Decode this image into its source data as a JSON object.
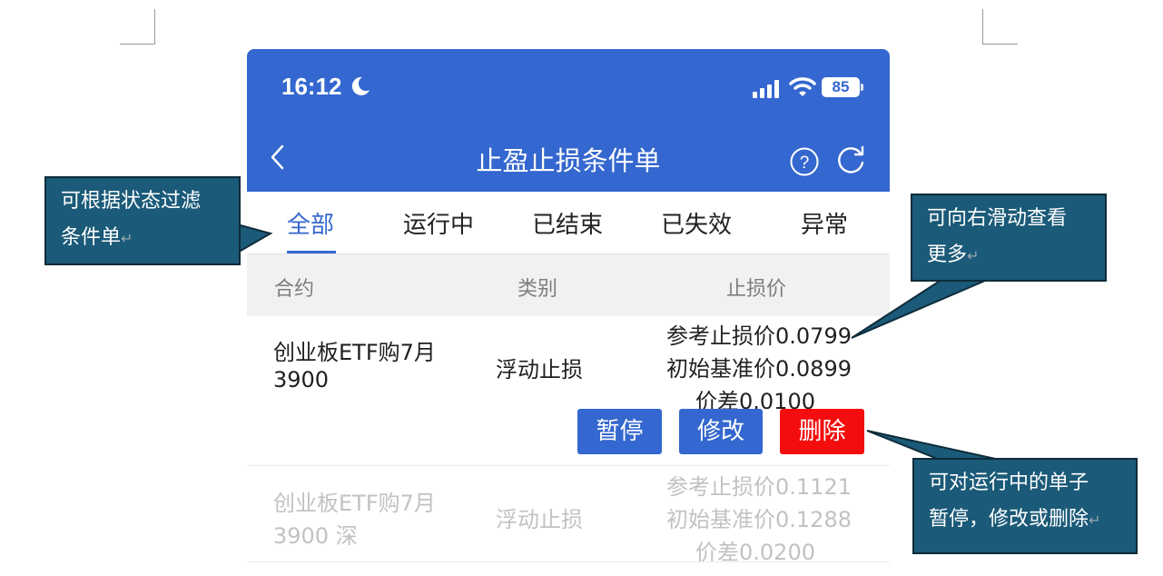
{
  "status_bar": {
    "time": "16:12",
    "battery": "85"
  },
  "nav": {
    "title": "止盈止损条件单"
  },
  "tabs": [
    {
      "label": "全部"
    },
    {
      "label": "运行中"
    },
    {
      "label": "已结束"
    },
    {
      "label": "已失效"
    },
    {
      "label": "异常"
    }
  ],
  "columns": {
    "contract": "合约",
    "type": "类别",
    "stop_price": "止损价"
  },
  "orders": [
    {
      "contract_line1": "创业板ETF购7月",
      "contract_line2": "3900",
      "type": "浮动止损",
      "ref_stop": "参考止损价0.0799",
      "base_price": "初始基准价0.0899",
      "spread": "价差0.0100",
      "actions": {
        "pause": "暂停",
        "edit": "修改",
        "delete": "删除"
      }
    },
    {
      "contract_line1": "创业板ETF购7月",
      "contract_line2": "3900 深",
      "type": "浮动止损",
      "ref_stop": "参考止损价0.1121",
      "base_price": "初始基准价0.1288",
      "spread": "价差0.0200"
    }
  ],
  "callouts": {
    "filter": {
      "line1": "可根据状态过滤",
      "line2": "条件单",
      "mark": "↵"
    },
    "scroll": {
      "line1": "可向右滑动查看",
      "line2": "更多",
      "mark": "↵"
    },
    "actions": {
      "line1": "可对运行中的单子",
      "line2": "暂停，修改或删除",
      "mark": "↵"
    }
  },
  "colors": {
    "primary": "#3467cf",
    "danger": "#f40d0d",
    "callout": "#1b5a78"
  },
  "icons": [
    "moon-icon",
    "signal-icon",
    "wifi-icon",
    "back-icon",
    "help-icon",
    "refresh-icon"
  ]
}
